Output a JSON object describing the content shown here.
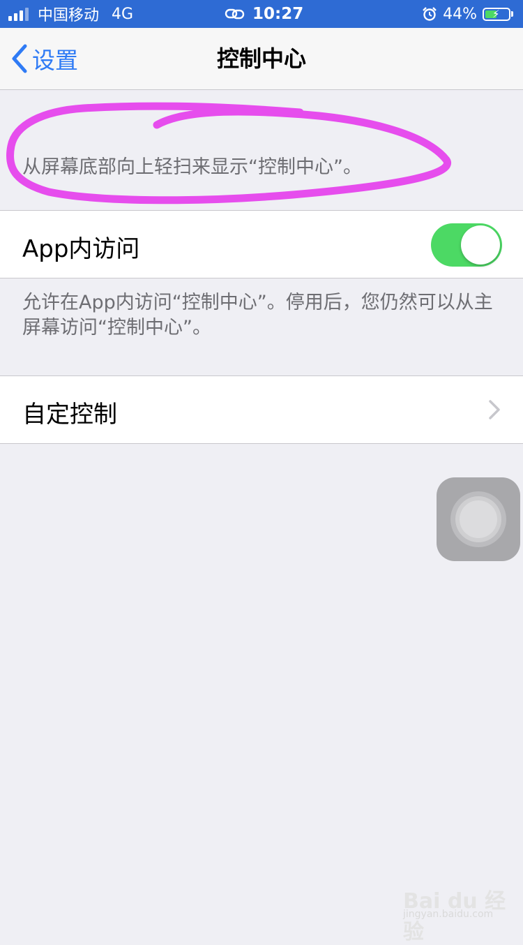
{
  "status_bar": {
    "carrier": "中国移动",
    "network": "4G",
    "time": "10:27",
    "battery_percent": "44%",
    "battery_level": 0.44,
    "icons": [
      "signal-icon",
      "link-icon",
      "alarm-icon",
      "battery-charging-icon"
    ]
  },
  "nav": {
    "back_label": "设置",
    "title": "控制中心"
  },
  "section_top": {
    "note": "从屏幕底部向上轻扫来显示“控制中心”。",
    "highlight_color": "#e64ded"
  },
  "access_group": {
    "label": "App内访问",
    "toggle_on": true,
    "footer": "允许在App内访问“控制中心”。停用后，您仍然可以从主屏幕访问“控制中心”。"
  },
  "customize_group": {
    "label": "自定控制"
  },
  "colors": {
    "accent": "#2f7bf5",
    "toggle_on": "#4cd964",
    "status_bar": "#2e6bd4",
    "background": "#efeff4"
  },
  "watermark": {
    "main": "Bai du 经验",
    "sub": "jingyan.baidu.com"
  }
}
